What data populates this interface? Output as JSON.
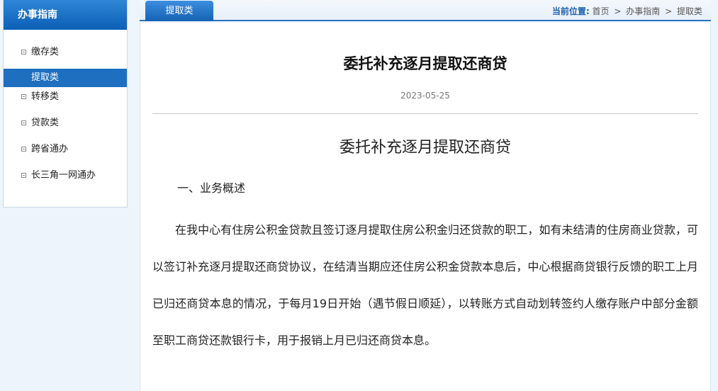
{
  "sidebar": {
    "title": "办事指南",
    "items": [
      {
        "label": "缴存类",
        "active": false
      },
      {
        "label": "提取类",
        "active": true
      },
      {
        "label": "转移类",
        "active": false
      },
      {
        "label": "贷款类",
        "active": false
      },
      {
        "label": "跨省通办",
        "active": false
      },
      {
        "label": "长三角一网通办",
        "active": false
      }
    ]
  },
  "tabbar": {
    "active_tab": "提取类"
  },
  "breadcrumb": {
    "label": "当前位置:",
    "crumbs": [
      "首页",
      "办事指南",
      "提取类"
    ],
    "separator": ">"
  },
  "article": {
    "title": "委托补充逐月提取还商贷",
    "date": "2023-05-25",
    "content_heading": "委托补充逐月提取还商贷",
    "section_heading": "一、业务概述",
    "paragraph": "在我中心有住房公积金贷款且签订逐月提取住房公积金归还贷款的职工，如有未结清的住房商业贷款，可以签订补充逐月提取还商贷协议，在结清当期应还住房公积金贷款本息后，中心根据商贷银行反馈的职工上月已归还商贷本息的情况，于每月19日开始（遇节假日顺延），以转账方式自动划转签约人缴存账户中部分金额至职工商贷还款银行卡，用于报销上月已归还商贷本息。"
  },
  "colors": {
    "accent": "#1f6fc0",
    "sidebar_header": "#0b5fb6",
    "breadcrumb_label": "#1b62ad"
  }
}
